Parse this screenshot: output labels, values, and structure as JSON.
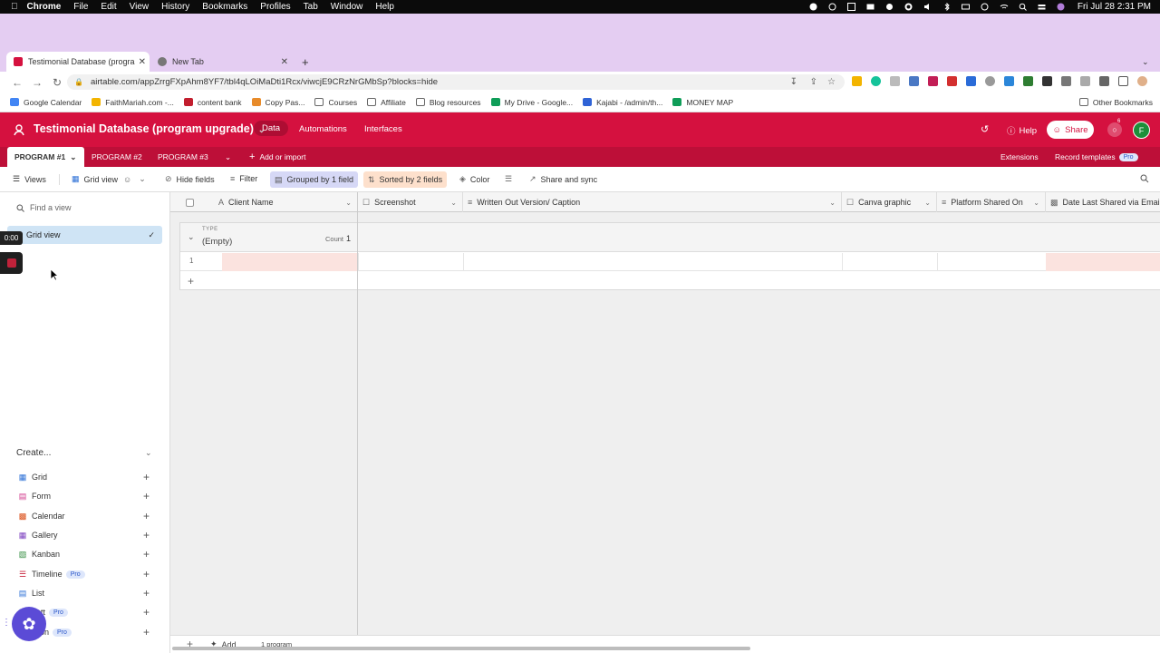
{
  "menubar": {
    "app": "Chrome",
    "items": [
      "File",
      "Edit",
      "View",
      "History",
      "Bookmarks",
      "Profiles",
      "Tab",
      "Window",
      "Help"
    ],
    "clock": "Fri Jul 28  2:31 PM"
  },
  "tabs": [
    {
      "title": "Testimonial Database (progran",
      "active": true
    },
    {
      "title": "New Tab",
      "active": false
    }
  ],
  "address": {
    "url": "airtable.com/appZrrgFXpAhm8YF7/tbl4qLOiMaDti1Rcx/viwcjE9CRzNrGMbSp?blocks=hide"
  },
  "bookmarks": [
    "Google Calendar",
    "FaithMariah.com -...",
    "content bank",
    "Copy Pas...",
    "Courses",
    "Affiliate",
    "Blog resources",
    "My Drive - Google...",
    "Kajabi - /admin/th...",
    "MONEY MAP"
  ],
  "other_bookmarks": "Other Bookmarks",
  "header": {
    "base_title": "Testimonial Database (program upgrade)",
    "nav": [
      "Data",
      "Automations",
      "Interfaces"
    ],
    "help": "Help",
    "share": "Share",
    "avatar_letter": "F",
    "notif_count": "6"
  },
  "tables": {
    "items": [
      "PROGRAM #1",
      "PROGRAM #2",
      "PROGRAM #3"
    ],
    "add_or_import": "Add or import",
    "extensions": "Extensions",
    "record_templates": "Record templates",
    "pro": "Pro"
  },
  "toolbar": {
    "views": "Views",
    "grid_view": "Grid view",
    "hide_fields": "Hide fields",
    "filter": "Filter",
    "grouped": "Grouped by 1 field",
    "sorted": "Sorted by 2 fields",
    "color": "Color",
    "share_sync": "Share and sync"
  },
  "sidebar": {
    "find_placeholder": "Find a view",
    "current_view": "Grid view",
    "create_header": "Create...",
    "create_items": [
      {
        "label": "Grid",
        "pro": false
      },
      {
        "label": "Form",
        "pro": false
      },
      {
        "label": "Calendar",
        "pro": false
      },
      {
        "label": "Gallery",
        "pro": false
      },
      {
        "label": "Kanban",
        "pro": false
      },
      {
        "label": "Timeline",
        "pro": true
      },
      {
        "label": "List",
        "pro": false
      },
      {
        "label": "antt",
        "pro": true
      },
      {
        "label": "ction",
        "pro": true
      }
    ],
    "pro_label": "Pro"
  },
  "grid": {
    "columns": [
      "Client Name",
      "Screenshot",
      "Written Out Version/ Caption",
      "Canva graphic",
      "Platform Shared On",
      "Date Last Shared via Email"
    ],
    "group_field": "TYPE",
    "group_value": "(Empty)",
    "count_label": "Count",
    "count_value": "1",
    "row_number": "1",
    "footer_add": "Add...",
    "footer_count": "1 program"
  },
  "recorder": {
    "time": "0:00"
  },
  "colors": {
    "brand": "#d5113f",
    "tables_bar": "#bd0f38",
    "chrome_frame": "#e4cdf2",
    "selection": "#cfe4f5"
  }
}
